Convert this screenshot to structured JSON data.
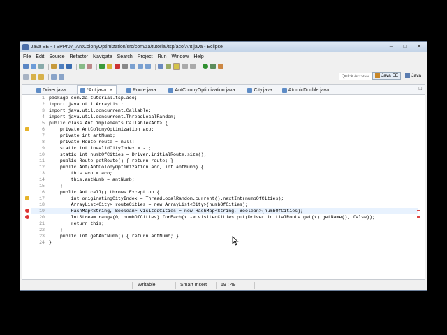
{
  "window": {
    "title": "Java EE - TSPPr07_AntColonyOptimization/src/com/za/tutorial/tsp/aco/Ant.java - Eclipse"
  },
  "menu": [
    "File",
    "Edit",
    "Source",
    "Refactor",
    "Navigate",
    "Search",
    "Project",
    "Run",
    "Window",
    "Help"
  ],
  "toolbar": {
    "quick_access_placeholder": "Quick Access",
    "perspectives": [
      "Java EE",
      "Java"
    ]
  },
  "tabs": [
    {
      "label": "Driver.java",
      "active": false
    },
    {
      "label": "*Ant.java",
      "active": true
    },
    {
      "label": "Route.java",
      "active": false
    },
    {
      "label": "AntColonyOptimization.java",
      "active": false
    },
    {
      "label": "City.java",
      "active": false
    },
    {
      "label": "AtomicDouble.java",
      "active": false
    }
  ],
  "code_lines": [
    {
      "n": "1",
      "text": "package com.za.tutorial.tsp.aco;"
    },
    {
      "n": "2",
      "text": "import java.util.ArrayList;"
    },
    {
      "n": "3",
      "text": "import java.util.concurrent.Callable;"
    },
    {
      "n": "4",
      "text": "import java.util.concurrent.ThreadLocalRandom;"
    },
    {
      "n": "5",
      "text": "public class Ant implements Callable<Ant> {"
    },
    {
      "n": "6",
      "text": "    private AntColonyOptimization aco;"
    },
    {
      "n": "7",
      "text": "    private int antNumb;"
    },
    {
      "n": "8",
      "text": "    private Route route = null;"
    },
    {
      "n": "9",
      "text": "    static int invalidCityIndex = -1;"
    },
    {
      "n": "10",
      "text": "    static int numbOfCities = Driver.initialRoute.size();"
    },
    {
      "n": "11",
      "text": "    public Route getRoute() { return route; }"
    },
    {
      "n": "12",
      "text": "    public Ant(AntColonyOptimization aco, int antNumb) {"
    },
    {
      "n": "13",
      "text": "        this.aco = aco;"
    },
    {
      "n": "14",
      "text": "        this.antNumb = antNumb;"
    },
    {
      "n": "15",
      "text": "    }"
    },
    {
      "n": "16",
      "text": "    public Ant call() throws Exception {"
    },
    {
      "n": "17",
      "text": "        int originatingCityIndex = ThreadLocalRandom.current().nextInt(numbOfCities);"
    },
    {
      "n": "18",
      "text": "        ArrayList<City> routeCities = new ArrayList<City>(numbOfCities);"
    },
    {
      "n": "19",
      "text": "        HashMap<String, Boolean> visitedCities = new HashMap<String, Boolean>(numbOfCities);"
    },
    {
      "n": "20",
      "text": "        IntStream.range(0, numbOfCities).forEach(x -> visitedCities.put(Driver.initialRoute.get(x).getName(), false));"
    },
    {
      "n": "21",
      "text": "        return this;"
    },
    {
      "n": "22",
      "text": "    }"
    },
    {
      "n": "23",
      "text": "    public int getAntNumb() { return antNumb; }"
    },
    {
      "n": "24",
      "text": "}"
    }
  ],
  "status": {
    "mode": "Writable",
    "insert": "Smart Insert",
    "position": "19 : 49"
  }
}
